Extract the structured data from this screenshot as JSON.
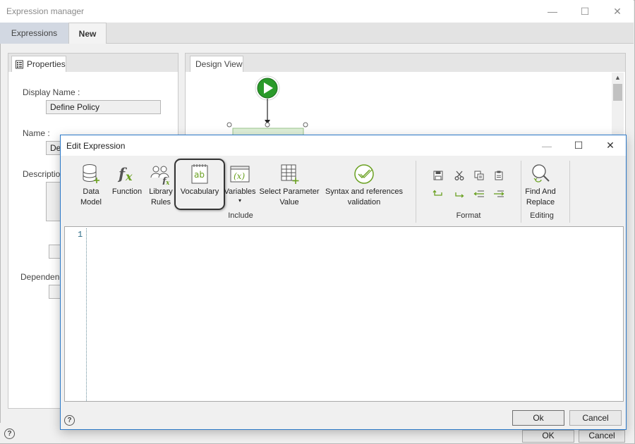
{
  "outer_window": {
    "title": "Expression manager",
    "minimize": "—",
    "maximize": "☐",
    "close": "✕",
    "tabs": [
      {
        "label": "Expressions"
      },
      {
        "label": "New"
      }
    ],
    "properties": {
      "tab_label": "Properties",
      "display_name_label": "Display Name :",
      "display_name_value": "Define Policy",
      "name_label": "Name :",
      "name_value_partial": "De",
      "description_label_partial": "Descriptio",
      "dependencies_label_partial": "Dependenc"
    },
    "design_view": {
      "tab_label": "Design View"
    },
    "ok_partial": "OK",
    "cancel_partial": "Cancel",
    "help": "?"
  },
  "dialog": {
    "title": "Edit Expression",
    "minimize": "—",
    "maximize": "☐",
    "close": "✕",
    "ribbon": {
      "include_buttons": [
        {
          "line1": "Data",
          "line2": "Model",
          "icon": "database-icon"
        },
        {
          "line1": "Function",
          "line2": "",
          "icon": "function-icon"
        },
        {
          "line1": "Library",
          "line2": "Rules",
          "icon": "library-rules-icon"
        },
        {
          "line1": "Vocabulary",
          "line2": "",
          "icon": "vocabulary-icon"
        },
        {
          "line1": "Variables",
          "line2": "▾",
          "icon": "variables-icon"
        },
        {
          "line1": "Select Parameter",
          "line2": "Value",
          "icon": "table-add-icon"
        },
        {
          "line1": "Syntax and references",
          "line2": "validation",
          "icon": "check-circle-icon"
        }
      ],
      "include_label": "Include",
      "format_label": "Format",
      "editing_buttons": [
        {
          "line1": "Find And",
          "line2": "Replace",
          "icon": "find-replace-icon"
        }
      ],
      "editing_label": "Editing"
    },
    "editor": {
      "line_number": "1",
      "content": ""
    },
    "ok_label": "Ok",
    "cancel_label": "Cancel",
    "help": "?"
  },
  "colors": {
    "accent_green": "#6aa121",
    "dialog_border": "#2a78c8",
    "start_node": "#2a9a2a"
  }
}
